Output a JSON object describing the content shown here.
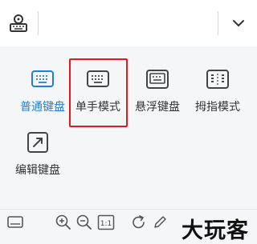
{
  "top_bar": {
    "logo_icon": "keyboard-settings-icon",
    "dropdown_icon": "chevron-down-icon"
  },
  "keyboard_modes": [
    {
      "label": "普通键盘",
      "icon": "keyboard-icon",
      "selected": true
    },
    {
      "label": "单手模式",
      "icon": "one-hand-keyboard-icon",
      "selected": false,
      "highlighted": true
    },
    {
      "label": "悬浮键盘",
      "icon": "floating-keyboard-icon",
      "selected": false
    },
    {
      "label": "拇指模式",
      "icon": "thumb-keyboard-icon",
      "selected": false
    },
    {
      "label": "编辑键盘",
      "icon": "edit-keyboard-icon",
      "selected": false
    }
  ],
  "bottom_toolbar": {
    "icons": [
      "keyboard-icon",
      "zoom-in-icon",
      "zoom-out-icon",
      "actual-size-icon",
      "rotate-icon",
      "pencil-icon"
    ],
    "actual_size_label": "1:1"
  },
  "watermark": "大玩客",
  "colors": {
    "accent": "#1f7fd8",
    "highlight_border": "#e21a1a",
    "icon": "#444444",
    "background": "#f5f6f8"
  }
}
